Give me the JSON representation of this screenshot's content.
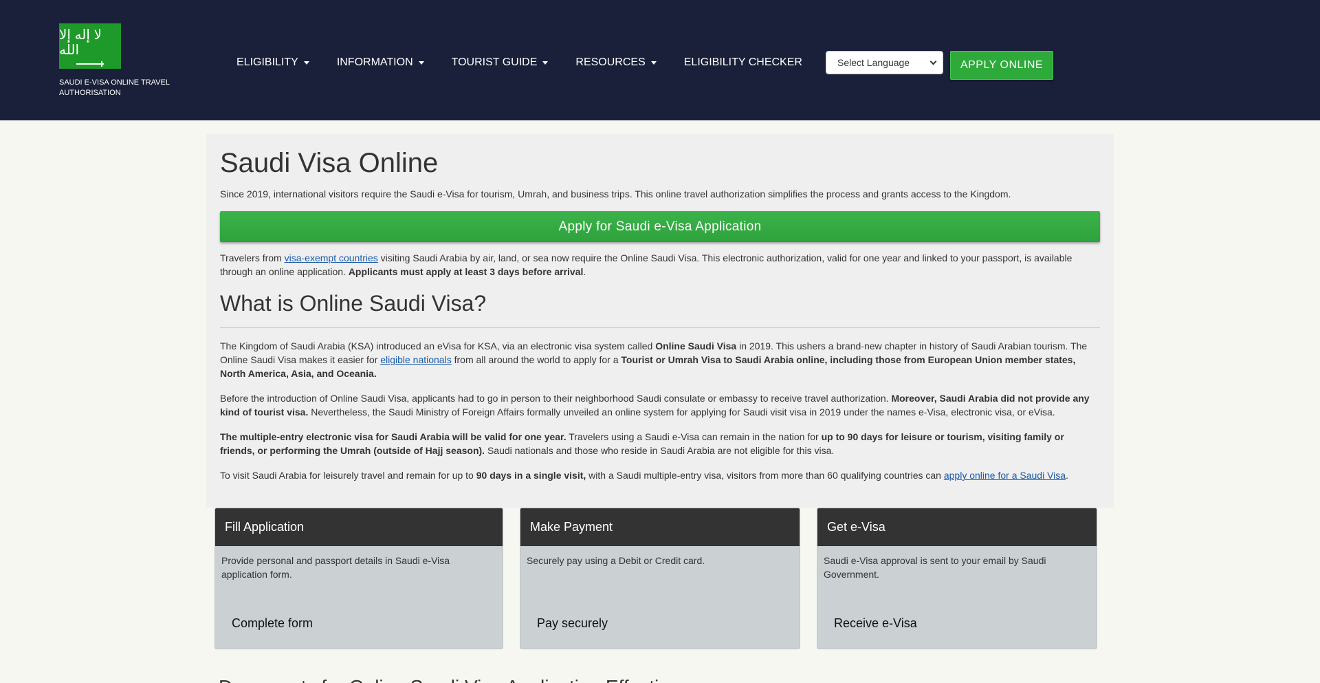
{
  "header": {
    "logo_script": "لا إله إلا الله",
    "logo_text": "SAUDI E-VISA ONLINE TRAVEL AUTHORISATION",
    "nav": [
      {
        "label": "ELIGIBILITY",
        "dropdown": true
      },
      {
        "label": "INFORMATION",
        "dropdown": true
      },
      {
        "label": "TOURIST GUIDE",
        "dropdown": true
      },
      {
        "label": "RESOURCES",
        "dropdown": true
      },
      {
        "label": "ELIGIBILITY CHECKER",
        "dropdown": false
      }
    ],
    "language_select": "Select Language",
    "apply_online": "APPLY ONLINE"
  },
  "main": {
    "title": "Saudi Visa Online",
    "intro": "Since 2019, international visitors require the Saudi e-Visa for tourism, Umrah, and business trips. This online travel authorization simplifies the process and grants access to the Kingdom.",
    "apply_button": "Apply for Saudi e-Visa Application",
    "p1": {
      "a": "Travelers from ",
      "link": "visa-exempt countries",
      "b": " visiting Saudi Arabia by air, land, or sea now require the Online Saudi Visa. This electronic authorization, valid for one year and linked to your passport, is available through an online application. ",
      "bold": "Applicants must apply at least 3 days before arrival",
      "end": "."
    },
    "section_title": "What is Online Saudi Visa?",
    "p2": {
      "a": "The Kingdom of Saudi Arabia (KSA) introduced an eVisa for KSA, via an electronic visa system called ",
      "bold1": "Online Saudi Visa",
      "b": " in 2019. This ushers a brand-new chapter in history of Saudi Arabian tourism. The Online Saudi Visa makes it easier for ",
      "link": "eligible nationals",
      "c": " from all around the world to apply for a ",
      "bold2": "Tourist or Umrah Visa to Saudi Arabia online, including those from European Union member states, North America, Asia, and Oceania."
    },
    "p3": {
      "a": "Before the introduction of Online Saudi Visa, applicants had to go in person to their neighborhood Saudi consulate or embassy to receive travel authorization. ",
      "bold": "Moreover, Saudi Arabia did not provide any kind of tourist visa.",
      "b": " Nevertheless, the Saudi Ministry of Foreign Affairs formally unveiled an online system for applying for Saudi visit visa in 2019 under the names e-Visa, electronic visa, or eVisa."
    },
    "p4": {
      "bold1": "The multiple-entry electronic visa for Saudi Arabia will be valid for one year.",
      "a": " Travelers using a Saudi e-Visa can remain in the nation for ",
      "bold2": "up to 90 days for leisure or tourism, visiting family or friends, or performing the Umrah (outside of Hajj season).",
      "b": " Saudi nationals and those who reside in Saudi Arabia are not eligible for this visa."
    },
    "p5": {
      "a": "To visit Saudi Arabia for leisurely travel and remain for up to ",
      "bold": "90 days in a single visit,",
      "b": " with a Saudi multiple-entry visa, visitors from more than 60 qualifying countries can ",
      "link": "apply online for a Saudi Visa",
      "end": "."
    }
  },
  "cards": [
    {
      "title": "Fill Application",
      "desc": "Provide personal and passport details in Saudi e-Visa application form.",
      "foot": "Complete form"
    },
    {
      "title": "Make Payment",
      "desc": "Securely pay using a Debit or Credit card.",
      "foot": "Pay securely"
    },
    {
      "title": "Get e-Visa",
      "desc": "Saudi e-Visa approval is sent to your email by Saudi Government.",
      "foot": "Receive e-Visa"
    }
  ],
  "bottom_heading": "Documents for Online Saudi Visa Application Effective..."
}
